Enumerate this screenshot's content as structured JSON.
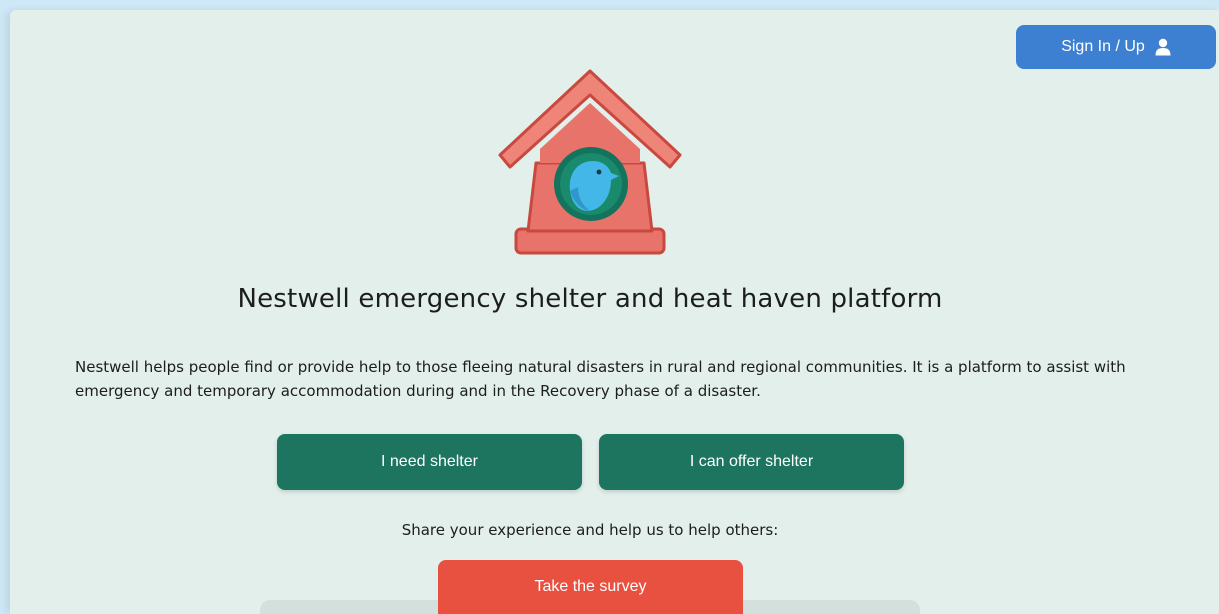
{
  "header": {
    "signin_label": "Sign In / Up",
    "signin_icon": "user-icon"
  },
  "logo": {
    "icon": "birdhouse-logo",
    "colors": {
      "house": "#e8736a",
      "house_stroke": "#c9483f",
      "roof_inner": "#ef8479",
      "hole_ring": "#14735c",
      "bird": "#43b7e8"
    }
  },
  "main": {
    "title": "Nestwell emergency shelter and heat haven platform",
    "description": "Nestwell helps people find or provide help to those fleeing natural disasters in rural and regional communities. It is a platform to assist with emergency and temporary accommodation during and in the Recovery phase of a disaster.",
    "need_shelter_label": "I need shelter",
    "offer_shelter_label": "I can offer shelter",
    "share_text": "Share your experience and help us to help others:",
    "survey_label": "Take the survey"
  },
  "colors": {
    "background": "#cfe8f7",
    "page": "#e2efea",
    "primary_green": "#1d7560",
    "signin_blue": "#3d7fd0",
    "survey_red": "#e8503f"
  }
}
